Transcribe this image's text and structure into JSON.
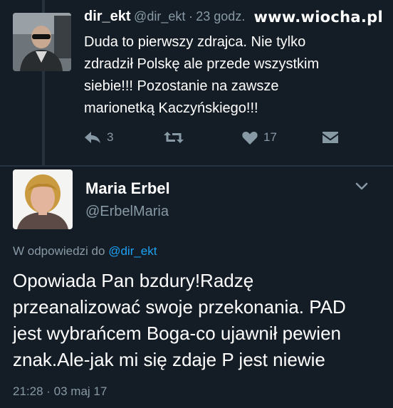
{
  "watermark": "www.wiocha.pl",
  "tweet1": {
    "name": "dir_ekt",
    "handle": "@dir_ekt",
    "separator": "·",
    "time": "23 godz.",
    "text_lines": [
      "Duda to pierwszy zdrajca. Nie tylko",
      "zdradził Polskę ale przede wszystkim",
      "siebie!!! Pozostanie na zawsze",
      "marionetką Kaczyńskiego!!!"
    ],
    "actions": {
      "reply_icon": "reply-icon",
      "reply_count": "3",
      "retweet_icon": "retweet-icon",
      "like_icon": "heart-icon",
      "like_count": "17",
      "dm_icon": "envelope-icon"
    }
  },
  "tweet2": {
    "name": "Maria Erbel",
    "handle": "@ErbelMaria",
    "menu_icon": "chevron-down-icon",
    "reply_prefix": "W odpowiedzi do",
    "reply_mention": "@dir_ekt",
    "text_lines": [
      "Opowiada Pan bzdury!Radzę",
      "przeanalizować swoje przekonania. PAD",
      "jest wybrańcem Boga-co ujawnił pewien",
      "znak.Ale-jak mi się zdaje P jest niewie"
    ],
    "timestamp": "21:28 · 03 maj 17"
  },
  "colors": {
    "background": "#141d26",
    "text": "#ffffff",
    "secondary": "#8899a6",
    "link": "#1da1f2",
    "divider": "#26333f"
  }
}
